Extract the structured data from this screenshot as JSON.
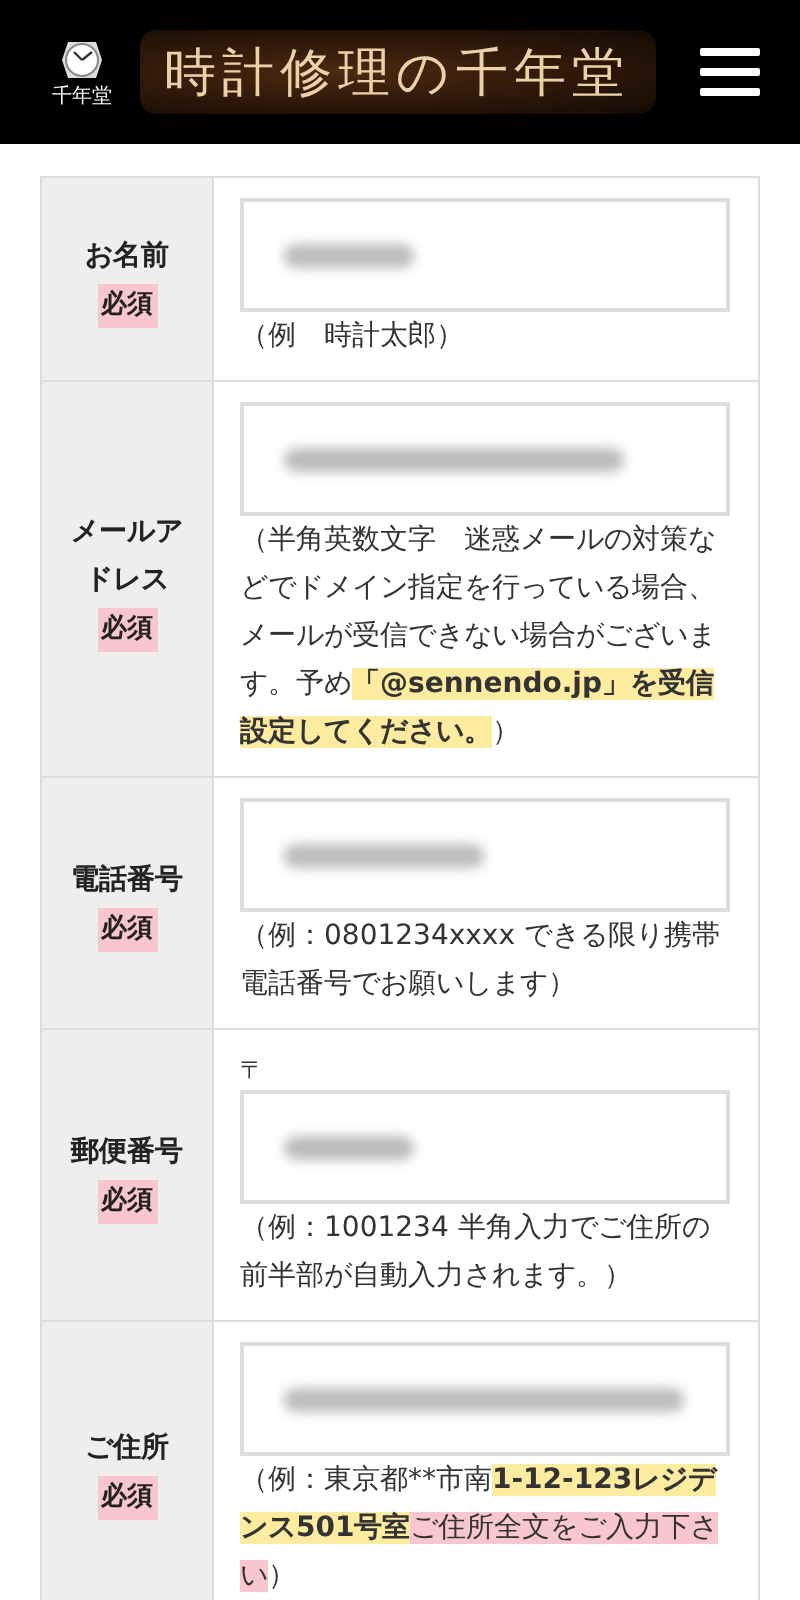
{
  "header": {
    "logo_text": "千年堂",
    "title": "時計修理の千年堂"
  },
  "rows": [
    {
      "label": "お名前",
      "badge": "必須",
      "prefix": null,
      "note": [
        {
          "text": "（例　時計太郎）"
        }
      ]
    },
    {
      "label": "メールアドレス",
      "badge": "必須",
      "prefix": null,
      "note": [
        {
          "text": "（半角英数文字　迷惑メールの対策などでドメイン指定を行っている場合、メールが受信できない場合がございます。予め"
        },
        {
          "text": "**「@sennendo.jp」を受信設定してください。**",
          "color": "#fdeba0"
        },
        {
          "text": "）"
        }
      ]
    },
    {
      "label": "電話番号",
      "badge": "必須",
      "prefix": null,
      "note": [
        {
          "text": "（例：0801234xxxx できる限り携帯電話番号でお願いします）"
        }
      ]
    },
    {
      "label": "郵便番号",
      "badge": "必須",
      "prefix": "〒",
      "note": [
        {
          "text": "（例：1001234 半角入力でご住所の前半部が自動入力されます。）"
        }
      ]
    },
    {
      "label": "ご住所",
      "badge": "必須",
      "prefix": null,
      "note": [
        {
          "text": "（例：東京都**市南"
        },
        {
          "text": "**1-12-123レジデンス501号室**",
          "color": "#fdeba0"
        },
        {
          "text": "ご住所全文をご入力下さい",
          "color": "#f8c6d0"
        },
        {
          "text": "）"
        }
      ]
    }
  ]
}
